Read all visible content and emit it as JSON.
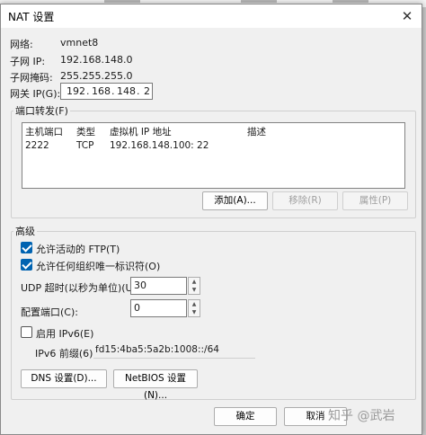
{
  "window": {
    "title": "NAT 设置"
  },
  "network": {
    "network_label": "网络:",
    "network_value": "vmnet8",
    "subnet_ip_label": "子网 IP:",
    "subnet_ip_value": "192.168.148.0",
    "subnet_mask_label": "子网掩码:",
    "subnet_mask_value": "255.255.255.0",
    "gateway_label": "网关 IP(G):",
    "gateway_octets": [
      "192",
      "168",
      "148",
      "2"
    ]
  },
  "port_forwarding": {
    "legend": "端口转发(F)",
    "columns": [
      "主机端口",
      "类型",
      "虚拟机 IP 地址",
      "描述"
    ],
    "rows": [
      {
        "host_port": "2222",
        "type": "TCP",
        "vm_ip": "192.168.148.100: 22",
        "description": ""
      }
    ],
    "add_label": "添加(A)...",
    "remove_label": "移除(R)",
    "properties_label": "属性(P)"
  },
  "advanced": {
    "legend": "高级",
    "allow_active_ftp_label": "允许活动的 FTP(T)",
    "allow_active_ftp_checked": true,
    "allow_any_oui_label": "允许任何组织唯一标识符(O)",
    "allow_any_oui_checked": true,
    "udp_timeout_label": "UDP 超时(以秒为单位)(U):",
    "udp_timeout_value": "30",
    "config_port_label": "配置端口(C):",
    "config_port_value": "0",
    "enable_ipv6_label": "启用 IPv6(E)",
    "enable_ipv6_checked": false,
    "ipv6_prefix_label": "IPv6 前缀(6):",
    "ipv6_prefix_value": "fd15:4ba5:5a2b:1008::/64",
    "dns_label": "DNS 设置(D)...",
    "netbios_label": "NetBIOS 设置(N)..."
  },
  "footer": {
    "ok_label": "确定",
    "cancel_label": "取消"
  },
  "watermark": "知乎 @武岩",
  "colors": {
    "accent": "#0063b1",
    "window_bg": "#f0f0f0"
  },
  "icons": {
    "close": "close-icon",
    "spin_up": "chevron-up-icon",
    "spin_down": "chevron-down-icon"
  }
}
